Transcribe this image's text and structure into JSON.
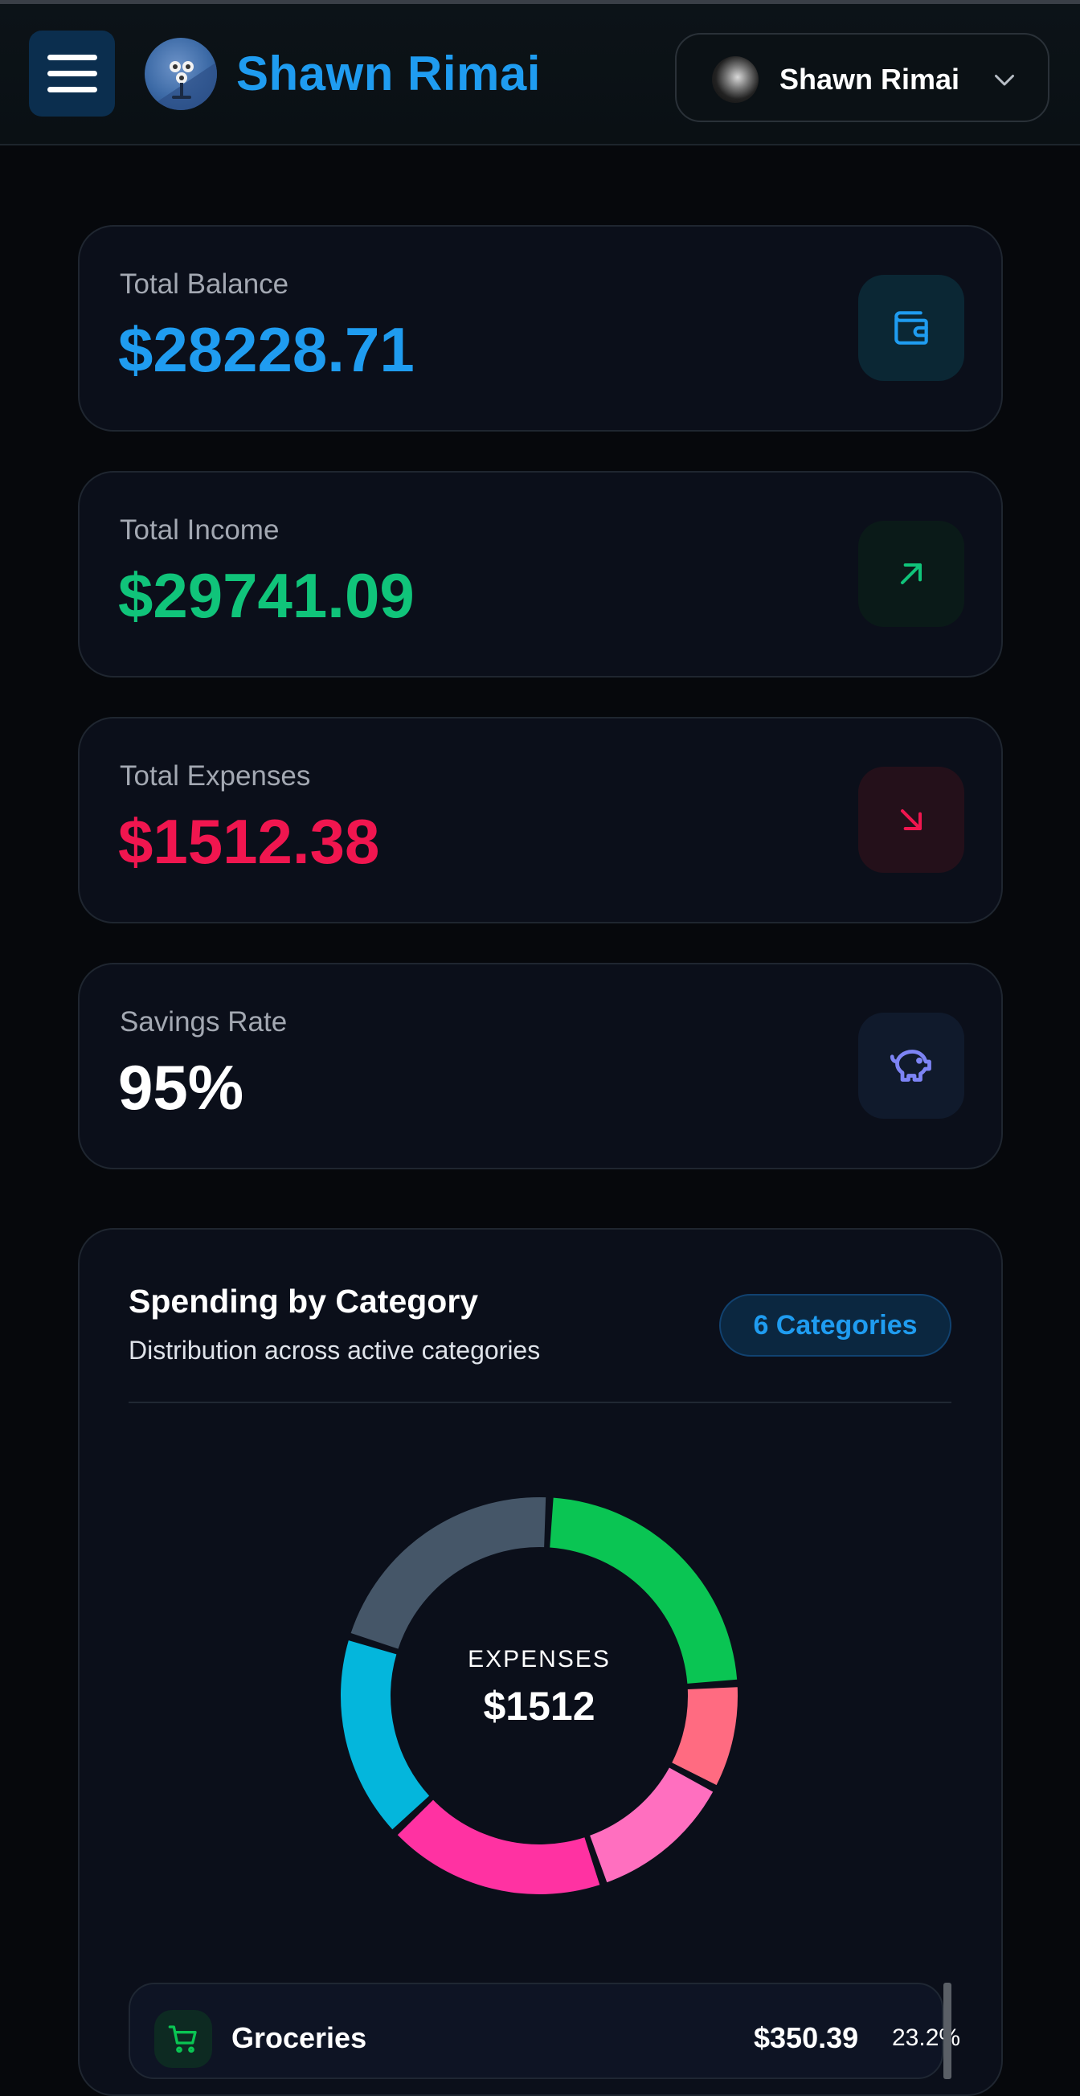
{
  "header": {
    "brand_title": "Shawn Rimai",
    "user_name": "Shawn Rimai",
    "menu_icon": "hamburger-icon",
    "chevron_icon": "chevron-down-icon"
  },
  "stats": [
    {
      "label": "Total Balance",
      "value": "$28228.71",
      "color": "#1f9cf0",
      "icon": "wallet-icon"
    },
    {
      "label": "Total Income",
      "value": "$29741.09",
      "color": "#10c47a",
      "icon": "arrow-up-right-icon"
    },
    {
      "label": "Total Expenses",
      "value": "$1512.38",
      "color": "#f0164f",
      "icon": "arrow-down-right-icon"
    },
    {
      "label": "Savings Rate",
      "value": "95%",
      "color": "#ffffff",
      "icon": "piggy-bank-icon"
    }
  ],
  "spending": {
    "title": "Spending by Category",
    "subtitle": "Distribution across active categories",
    "badge": "6 Categories",
    "center_label": "EXPENSES",
    "center_value": "$1512"
  },
  "chart_data": {
    "type": "pie",
    "slices": [
      {
        "value": 350.39,
        "color": "#0ac553"
      },
      {
        "value": 132,
        "color": "#ff6b81"
      },
      {
        "value": 182,
        "color": "#ff6fbf"
      },
      {
        "value": 275,
        "color": "#ff32a2"
      },
      {
        "value": 255,
        "color": "#04b6dc"
      },
      {
        "value": 318,
        "color": "#455668"
      }
    ]
  },
  "categories": [
    {
      "name": "Groceries",
      "amount": "$350.39",
      "percent": "23.2%",
      "icon": "shopping-cart-icon",
      "color": "#0ac553"
    }
  ]
}
